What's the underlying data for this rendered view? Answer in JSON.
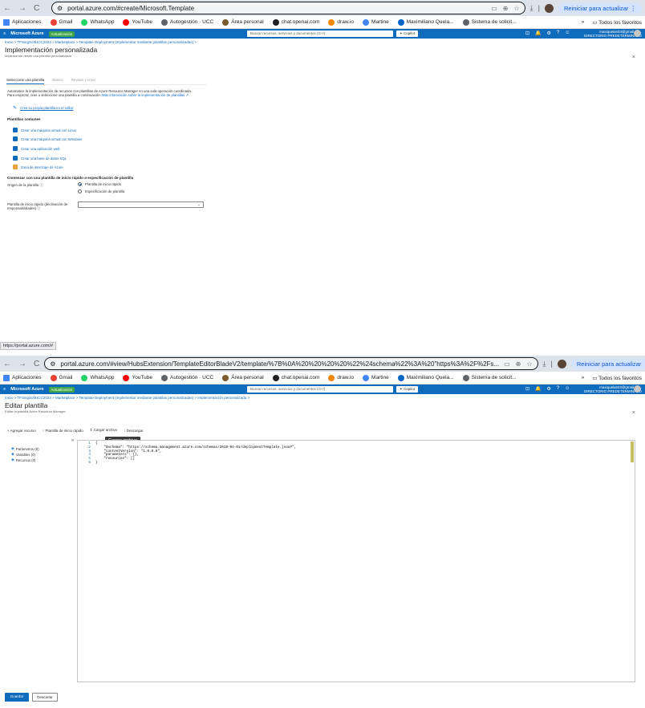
{
  "browser": {
    "nav_back": "←",
    "nav_forward": "→",
    "nav_reload": "C",
    "update_button": "Reiniciar para actualizar",
    "bookmarks": [
      {
        "label": "Aplicaciones",
        "icon": "apps-grid-icon",
        "color": "#4285f4"
      },
      {
        "label": "Gmail",
        "icon": "gmail-icon",
        "color": "#ea4335"
      },
      {
        "label": "WhatsApp",
        "icon": "whatsapp-icon",
        "color": "#25d366"
      },
      {
        "label": "YouTube",
        "icon": "youtube-icon",
        "color": "#ff0000"
      },
      {
        "label": "Autogestión · UCC",
        "icon": "globe-icon",
        "color": "#5f6368"
      },
      {
        "label": "Área personal",
        "icon": "page-icon",
        "color": "#7a5c2e"
      },
      {
        "label": "chat.openai.com",
        "icon": "chatgpt-icon",
        "color": "#202124"
      },
      {
        "label": "draw.io",
        "icon": "drawio-icon",
        "color": "#f08705"
      },
      {
        "label": "Martine",
        "icon": "martine-icon",
        "color": "#4285f4"
      },
      {
        "label": "Maximiliano Quela...",
        "icon": "linkedin-icon",
        "color": "#0a66c2"
      },
      {
        "label": "Sistema de solicit...",
        "icon": "globe-icon",
        "color": "#5f6368"
      }
    ],
    "more_bookmarks": "»",
    "all_favorites": "Todos los favoritos"
  },
  "azure": {
    "brand": "Microsoft Azure",
    "badge": "Actualización",
    "search_placeholder": "Buscar recursos, servicios y documentos (G+/)",
    "copilot": "Copilot",
    "account_email": "maxiquelas03@gmail.co...",
    "account_dir": "DIRECTORIO PREDETERMINADO",
    "close": "×"
  },
  "shotA": {
    "url": "portal.azure.com/#create/Microsoft.Template",
    "breadcrumb": "Inicio > TFSingSoftUCC2024 > Marketplace > Template Deployment (implementar mediante plantillas personalizadas) >",
    "title": "Implementación personalizada",
    "subtitle": "Implementar desde una plantilla personalizada",
    "tabs": [
      "Seleccione una plantilla",
      "Básico",
      "Revisar y crear"
    ],
    "intro_line1": "Automatice la implementación de recursos con plantillas de Azure Resource Manager en una sola operación coordinada.",
    "intro_line2": "Para empezar, cree o seleccione una plantilla a continuación.",
    "intro_link": "Más información sobre la implementación de plantillas",
    "editor_link": "Cree su propia plantilla en el editor",
    "common_heading": "Plantillas comunes",
    "common_templates": [
      {
        "label": "Crear una máquina virtual con Linux",
        "icon": "vm-linux-icon",
        "color": "#0f6cbd"
      },
      {
        "label": "Crear una máquina virtual con Windows",
        "icon": "vm-windows-icon",
        "color": "#0f6cbd"
      },
      {
        "label": "Crear una aplicación web",
        "icon": "web-app-icon",
        "color": "#0f6cbd"
      },
      {
        "label": "Crear una base de datos SQL",
        "icon": "sql-database-icon",
        "color": "#0f6cbd"
      },
      {
        "label": "Zona de aterrizaje de Azure",
        "icon": "landing-zone-icon",
        "color": "#e8a33a"
      }
    ],
    "quickstart_heading": "Comenzar con una plantilla de inicio rápido o especificación de plantilla",
    "source_label": "Origen de la plantilla",
    "radio_options": [
      {
        "label": "Plantilla de inicio rápido",
        "selected": true
      },
      {
        "label": "Especificación de plantilla",
        "selected": false
      }
    ],
    "quickstart_label_line1": "Plantilla de inicio rápido (declinación de",
    "quickstart_label_line2": "responsabilidades)",
    "dropdown_value": "",
    "status_url": "https://portal.azure.com/#"
  },
  "shotB": {
    "url": "portal.azure.com/#view/HubsExtension/TemplateEditorBladeV2/template/%7B%0A%20%20%20%20%22%24schema%22%3A%20\"https%3A%2F%2Fs...",
    "breadcrumb": "Inicio > TFSingSoftUCC2024 > Marketplace > Template Deployment (implementar mediante plantillas personalizadas) > Implementación personalizada >",
    "title": "Editar plantilla",
    "subtitle": "Editar la plantilla Azure Resource Manager",
    "toolbar": [
      {
        "label": "Agregar recurso",
        "icon": "+"
      },
      {
        "label": "Plantilla de inicio rápido",
        "icon": "↑"
      },
      {
        "label": "Cargar archivo",
        "icon": "↥"
      },
      {
        "label": "Descargar",
        "icon": "↓"
      }
    ],
    "tooltip": "Cargar archivo",
    "collapse": "«",
    "tree": [
      {
        "label": "Parámetros (0)",
        "icon": "parameters-icon"
      },
      {
        "label": "Variables (0)",
        "icon": "variables-icon"
      },
      {
        "label": "Recursos (0)",
        "icon": "resources-icon"
      }
    ],
    "code_lines": [
      "{",
      "    \"$schema\": \"https://schema.management.azure.com/schemas/2019-04-01/deploymentTemplate.json#\",",
      "    \"contentVersion\": \"1.0.0.0\",",
      "    \"parameters\": {},",
      "    \"resources\": []",
      "}"
    ],
    "line_numbers": [
      "1",
      "2",
      "3",
      "4",
      "5",
      "6"
    ],
    "save_button": "Guardar",
    "discard_button": "Descartar"
  }
}
